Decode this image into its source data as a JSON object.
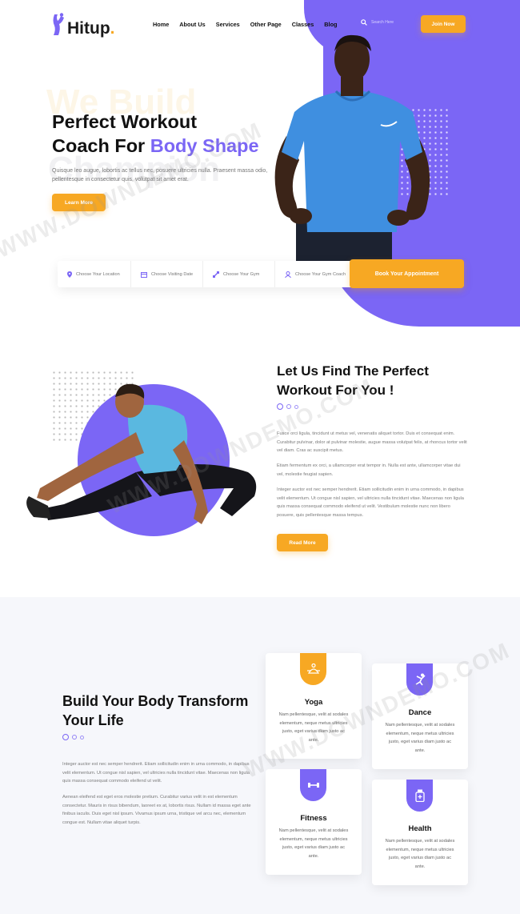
{
  "brand": {
    "name": "Hitup",
    "dot": ".",
    "accent_color": "#7b66f5",
    "cta_color": "#f7a823"
  },
  "nav": {
    "items": [
      "Home",
      "About Us",
      "Services",
      "Other Page",
      "Classes",
      "Blog"
    ]
  },
  "header": {
    "search_placeholder": "Search Here",
    "join_label": "Join Now"
  },
  "hero": {
    "bg_word_1": "We Build",
    "bg_word_2": "Champion",
    "title_line1": "Perfect Workout",
    "title_line2_plain": "Coach For ",
    "title_line2_accent": "Body Shape",
    "description": "Quisque leo augue, lobortis ac tellus nec, posuere ultricies nulla. Praesent massa odio, pellentesque in consectetur quis, volutpat sit amet erat.",
    "learn_label": "Learn More"
  },
  "booking": {
    "location": "Choose Your Location",
    "date": "Choose Visiting Date",
    "gym": "Choose Your Gym",
    "coach": "Choose Your Gym Coach",
    "button": "Book Your Appointment"
  },
  "about": {
    "title_line1": "Let Us Find The Perfect",
    "title_line2": "Workout For You !",
    "p1": "Fusce orci ligula, tincidunt ut metus vel, venenatis aliquet tortor. Duis et consequat enim. Curabitur pulvinar, dolor at pulvinar molestie, augue massa volutpat felis, at rhoncus tortor velit vel diam. Cras ac suscipit metus.",
    "p2": "Etiam fermentum ex orci, a ullamcorper erat tempor in. Nulla est ante, ullamcorper vitae dui vel, molestie feugiat sapien.",
    "p3": "Integer auctor est nec semper hendrerit. Etiam sollicitudin enim in urna commodo, in dapibus velit elementum. Ut congue nisl sapien, vel ultricies nulla tincidunt vitae. Maecenas non ligula quis massa consequat commodo eleifend ut velit. Vestibulum molestie nunc non libero posuere, quis pellentesque massa tempus.",
    "read_label": "Read More"
  },
  "services": {
    "title_line1": "Build Your Body Transform",
    "title_line2": "Your Life",
    "p1": "Integer auctor est nec semper hendrerit. Etiam sollicitudin enim in urna commodo, in dapibus velit elementum. Ut congue nisl sapien, vel ultricies nulla tincidunt vitae. Maecenas non ligula quis massa consequat commodo eleifend ut velit.",
    "p2": "Aenean eleifend est eget eros molestie pretium. Curabitur varius velit in est elementum consectetur. Mauris in risus bibendum, laoreet ex at, lobortis risus. Nullam id massa eget ante finibus iaculis. Duis eget nisl ipsum. Vivamus ipsum urna, tristique vel arcu nec, elementum congue est. Nullam vitae aliquet turpis.",
    "cards": [
      {
        "title": "Yoga",
        "desc": "Nam pellentesque, velit at sodales elementum, neque metus ultricies justo, eget varius diam justo ac ante.",
        "icon": "lotus-icon"
      },
      {
        "title": "Dance",
        "desc": "Nam pellentesque, velit at sodales elementum, neque metus ultricies justo, eget varius diam justo ac ante.",
        "icon": "dancer-icon"
      },
      {
        "title": "Fitness",
        "desc": "Nam pellentesque, velit at sodales elementum, neque metus ultricies justo, eget varius diam justo ac ante.",
        "icon": "dumbbell-icon"
      },
      {
        "title": "Health",
        "desc": "Nam pellentesque, velit at sodales elementum, neque metus ultricies justo, eget varius diam justo ac ante.",
        "icon": "medicine-bottle-icon"
      }
    ]
  },
  "watermark": "WWW.DOWNDEMO.COM"
}
